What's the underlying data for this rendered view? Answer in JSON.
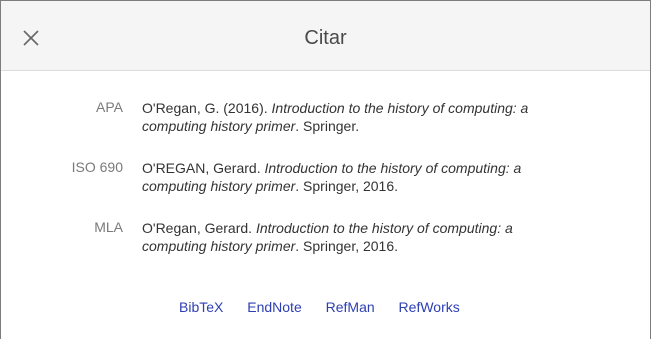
{
  "dialog": {
    "title": "Citar",
    "close_icon": "close-icon"
  },
  "citations": [
    {
      "style": "APA",
      "prefix": "O'Regan, G. (2016). ",
      "title_line1": "Introduction to the history of computing: a",
      "title_line2": "computing history primer",
      "suffix": ". Springer."
    },
    {
      "style": "ISO 690",
      "prefix": "O'REGAN, Gerard. ",
      "title_line1": "Introduction to the history of computing: a",
      "title_line2": "computing history primer",
      "suffix": ". Springer, 2016."
    },
    {
      "style": "MLA",
      "prefix": "O'Regan, Gerard. ",
      "title_line1": "Introduction to the history of computing: a",
      "title_line2": "computing history primer",
      "suffix": ". Springer, 2016."
    }
  ],
  "export_links": [
    "BibTeX",
    "EndNote",
    "RefMan",
    "RefWorks"
  ],
  "colors": {
    "link": "#2d3fb3",
    "header_bg": "#f5f5f5",
    "label": "#7a7a7a"
  }
}
